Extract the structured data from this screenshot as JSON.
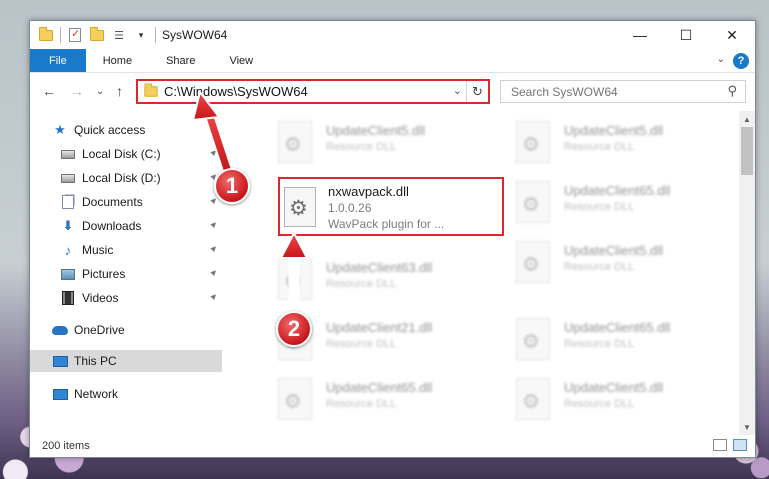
{
  "window": {
    "title": "SysWOW64",
    "controls": {
      "minimize": "—",
      "maximize": "☐",
      "close": "✕"
    },
    "help": "?",
    "collapse": "⌄"
  },
  "ribbon": {
    "tabs": [
      "File",
      "Home",
      "Share",
      "View"
    ]
  },
  "nav": {
    "back": "←",
    "forward": "→",
    "recent": "⌄",
    "up": "↑",
    "address": "C:\\Windows\\SysWOW64",
    "address_dropdown": "⌄",
    "refresh": "↻",
    "search_placeholder": "Search SysWOW64",
    "search_icon": "⚲"
  },
  "sidebar": {
    "items": [
      {
        "label": "Quick access",
        "icon": "star-icon",
        "pinned": false
      },
      {
        "label": "Local Disk (C:)",
        "icon": "drive-icon",
        "pinned": true
      },
      {
        "label": "Local Disk (D:)",
        "icon": "drive-icon",
        "pinned": true
      },
      {
        "label": "Documents",
        "icon": "documents-icon",
        "pinned": true
      },
      {
        "label": "Downloads",
        "icon": "download-icon",
        "pinned": true
      },
      {
        "label": "Music",
        "icon": "music-icon",
        "pinned": true
      },
      {
        "label": "Pictures",
        "icon": "pictures-icon",
        "pinned": true
      },
      {
        "label": "Videos",
        "icon": "videos-icon",
        "pinned": true
      },
      {
        "label": "OneDrive",
        "icon": "cloud-icon",
        "pinned": false
      },
      {
        "label": "This PC",
        "icon": "computer-icon",
        "pinned": false,
        "selected": true
      },
      {
        "label": "Network",
        "icon": "network-icon",
        "pinned": false
      }
    ],
    "pin_glyph": "📌"
  },
  "files": {
    "left_column": [
      {
        "name": "UpdateClient5.dll",
        "type": "Resource DLL"
      },
      {
        "name": "UpdateClient63.dll",
        "type": "Resource DLL"
      },
      {
        "name": "UpdateClient21.dll",
        "type": "Resource DLL"
      },
      {
        "name": "UpdateClient65.dll",
        "type": "Resource DLL"
      }
    ],
    "right_column": [
      {
        "name": "UpdateClient5.dll",
        "type": "Resource DLL"
      },
      {
        "name": "UpdateClient65.dll",
        "type": "Resource DLL"
      },
      {
        "name": "UpdateClient5.dll",
        "type": "Resource DLL"
      },
      {
        "name": "UpdateClient65.dll",
        "type": "Resource DLL"
      },
      {
        "name": "UpdateClient5.dll",
        "type": "Resource DLL"
      }
    ],
    "highlighted": {
      "name": "nxwavpack.dll",
      "version": "1.0.0.26",
      "description": "WavPack plugin for ..."
    }
  },
  "status": {
    "item_count": "200 items"
  },
  "annotations": {
    "step1": "1",
    "step2": "2"
  },
  "colors": {
    "accent": "#1979ca",
    "highlight": "#e0262a",
    "selected": "#d9d9d9"
  }
}
